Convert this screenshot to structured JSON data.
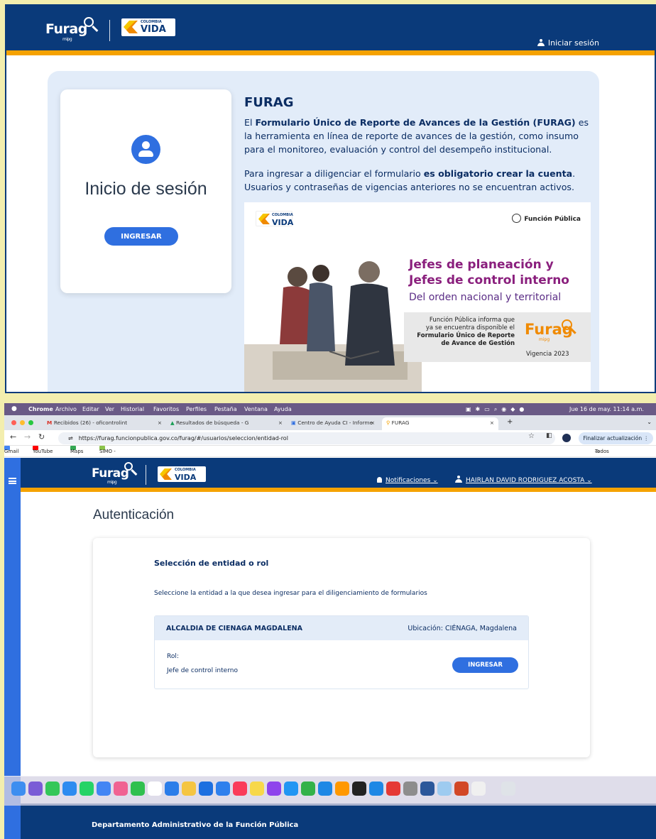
{
  "top": {
    "brand": {
      "furag": "Furag",
      "mipg": "mipg",
      "vida_top": "COLOMBIA",
      "vida_main": "VIDA"
    },
    "login_link": "Iniciar sesión",
    "login_card": {
      "title": "Inicio de sesión",
      "button": "INGRESAR"
    },
    "info": {
      "title": "FURAG",
      "p1_pre": "El ",
      "p1_bold": "Formulario Único de Reporte de Avances de la Gestión (FURAG)",
      "p1_post": " es la herramienta en línea de reporte de avances de la gestión, como insumo para el monitoreo, evaluación y control del desempeño institucional.",
      "p2_pre": "Para ingresar a diligenciar el formulario ",
      "p2_bold": "es obligatorio crear la cuenta",
      "p2_post": ". Usuarios y contraseñas de vigencias anteriores no se encuentran activos."
    },
    "banner": {
      "vida_top": "COLOMBIA",
      "vida_main": "VIDA",
      "funcion_publica": "Función Pública",
      "h1": "Jefes de planeación y",
      "h2": "Jefes de control interno",
      "h3": "Del orden nacional y territorial",
      "box_line1": "Función Pública informa que",
      "box_line2": "ya se encuentra disponible el",
      "box_bold1": "Formulario Único de Reporte",
      "box_bold2": "de Avance de Gestión",
      "furag": "Furag",
      "mipg": "mipg",
      "vigencia": "Vigencia 2023"
    }
  },
  "bottom": {
    "menubar": {
      "apple": "",
      "items": [
        "Chrome",
        "Archivo",
        "Editar",
        "Ver",
        "Historial",
        "Favoritos",
        "Perfiles",
        "Pestaña",
        "Ventana",
        "Ayuda"
      ],
      "datetime": "Jue 16 de may.  11:14 a.m."
    },
    "tabs": [
      {
        "label": "Recibidos (26) - oficontrolint",
        "close": "×"
      },
      {
        "label": "Resultados de búsqueda - G",
        "close": "×"
      },
      {
        "label": "Centro de Ayuda CI - Informe",
        "close": "×"
      },
      {
        "label": "FURAG",
        "close": "×"
      }
    ],
    "new_tab": "+",
    "url": "https://furag.funcionpublica.gov.co/furag/#/usuarios/seleccion/entidad-rol",
    "update_button": "Finalizar actualización",
    "bookmarks": [
      "Gmail",
      "YouTube",
      "Maps",
      "SIMO -Sistema de..."
    ],
    "all_bookmarks": "Todos los favoritos",
    "header": {
      "furag": "Furag",
      "mipg": "mipg",
      "vida_top": "COLOMBIA",
      "vida_main": "VIDA",
      "notifications": "Notificaciones",
      "user": "HAIRLAN DAVID RODRIGUEZ ACOSTA"
    },
    "page_title": "Autenticación",
    "selection": {
      "title": "Selección de entidad o rol",
      "description": "Seleccione la entidad a la que desea ingresar para el diligenciamiento de formularios",
      "entity_name": "ALCALDIA DE CIENAGA MAGDALENA",
      "entity_location": "Ubicación: CIÉNAGA, Magdalena",
      "role_label": "Rol:",
      "role_value": "Jefe de control interno",
      "button": "INGRESAR"
    },
    "footer": "Departamento Administrativo de la Función Pública"
  },
  "colors": {
    "header_blue": "#0a3a7a",
    "accent_orange": "#f5a200",
    "button_blue": "#2f6fe0",
    "text_navy": "#0b2d63"
  }
}
